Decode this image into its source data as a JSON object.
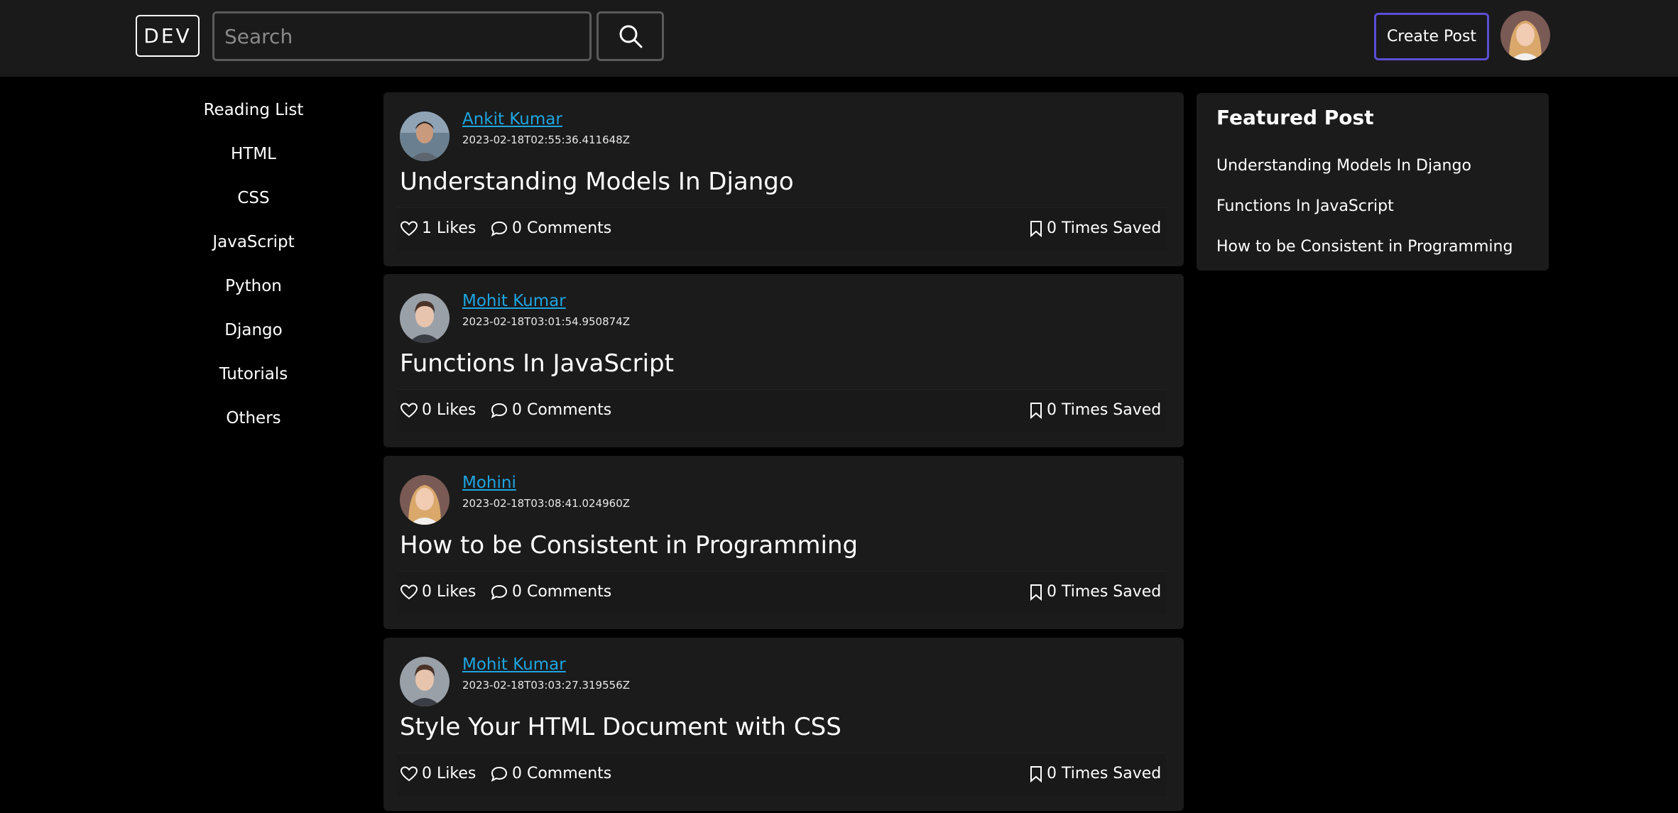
{
  "navbar": {
    "logo": "DEV",
    "search_placeholder": "Search",
    "search_icon": "search-icon",
    "create_post_label": "Create Post",
    "avatar_icon": "user-avatar"
  },
  "sidebar": {
    "items": [
      {
        "label": "Reading List"
      },
      {
        "label": "HTML"
      },
      {
        "label": "CSS"
      },
      {
        "label": "JavaScript"
      },
      {
        "label": "Python"
      },
      {
        "label": "Django"
      },
      {
        "label": "Tutorials"
      },
      {
        "label": "Others"
      }
    ]
  },
  "posts": [
    {
      "author": "Ankit Kumar",
      "timestamp": "2023-02-18T02:55:36.411648Z",
      "title": "Understanding Models In Django",
      "likes": "1 Likes",
      "comments": "0 Comments",
      "saved": "0 Times Saved"
    },
    {
      "author": "Mohit Kumar",
      "timestamp": "2023-02-18T03:01:54.950874Z",
      "title": "Functions In JavaScript",
      "likes": "0 Likes",
      "comments": "0 Comments",
      "saved": "0 Times Saved"
    },
    {
      "author": "Mohini",
      "timestamp": "2023-02-18T03:08:41.024960Z",
      "title": "How to be Consistent in Programming",
      "likes": "0 Likes",
      "comments": "0 Comments",
      "saved": "0 Times Saved"
    },
    {
      "author": "Mohit Kumar",
      "timestamp": "2023-02-18T03:03:27.319556Z",
      "title": "Style Your HTML Document with CSS",
      "likes": "0 Likes",
      "comments": "0 Comments",
      "saved": "0 Times Saved"
    }
  ],
  "featured": {
    "title": "Featured Post",
    "items": [
      {
        "label": "Understanding Models In Django"
      },
      {
        "label": "Functions In JavaScript"
      },
      {
        "label": "How to be Consistent in Programming"
      }
    ]
  },
  "colors": {
    "background": "#000000",
    "surface": "#1b1b1b",
    "link": "#1ea5e0",
    "accent": "#5b4fd6"
  }
}
